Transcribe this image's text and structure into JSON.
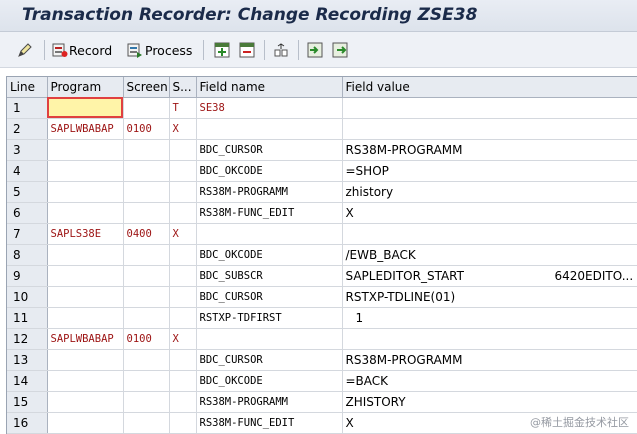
{
  "window": {
    "title": "Transaction Recorder: Change Recording ZSE38"
  },
  "toolbar": {
    "record_label": "Record",
    "process_label": "Process",
    "icons": [
      "edit-pencil-icon",
      "record-icon",
      "process-icon",
      "insert-row-icon",
      "delete-row-icon",
      "screen-icon",
      "import-icon",
      "export-icon"
    ]
  },
  "grid": {
    "columns": [
      "Line",
      "Program",
      "Screen",
      "S...",
      "Field name",
      "Field value"
    ],
    "rows": [
      {
        "line": "1",
        "program": "",
        "screen": "",
        "s": "T",
        "field": "SE38",
        "value": "",
        "value2": ""
      },
      {
        "line": "2",
        "program": "SAPLWBABAP",
        "screen": "0100",
        "s": "X",
        "field": "",
        "value": "",
        "value2": ""
      },
      {
        "line": "3",
        "program": "",
        "screen": "",
        "s": "",
        "field": "BDC_CURSOR",
        "value": "RS38M-PROGRAMM",
        "value2": ""
      },
      {
        "line": "4",
        "program": "",
        "screen": "",
        "s": "",
        "field": "BDC_OKCODE",
        "value": "=SHOP",
        "value2": ""
      },
      {
        "line": "5",
        "program": "",
        "screen": "",
        "s": "",
        "field": "RS38M-PROGRAMM",
        "value": "zhistory",
        "value2": ""
      },
      {
        "line": "6",
        "program": "",
        "screen": "",
        "s": "",
        "field": "RS38M-FUNC_EDIT",
        "value": "X",
        "value2": ""
      },
      {
        "line": "7",
        "program": "SAPLS38E",
        "screen": "0400",
        "s": "X",
        "field": "",
        "value": "",
        "value2": ""
      },
      {
        "line": "8",
        "program": "",
        "screen": "",
        "s": "",
        "field": "BDC_OKCODE",
        "value": "/EWB_BACK",
        "value2": ""
      },
      {
        "line": "9",
        "program": "",
        "screen": "",
        "s": "",
        "field": "BDC_SUBSCR",
        "value": "SAPLEDITOR_START",
        "value2": "6420EDITO..."
      },
      {
        "line": "10",
        "program": "",
        "screen": "",
        "s": "",
        "field": "BDC_CURSOR",
        "value": "RSTXP-TDLINE(01)",
        "value2": ""
      },
      {
        "line": "11",
        "program": "",
        "screen": "",
        "s": "",
        "field": "RSTXP-TDFIRST",
        "value": "1",
        "value2": ""
      },
      {
        "line": "12",
        "program": "SAPLWBABAP",
        "screen": "0100",
        "s": "X",
        "field": "",
        "value": "",
        "value2": ""
      },
      {
        "line": "13",
        "program": "",
        "screen": "",
        "s": "",
        "field": "BDC_CURSOR",
        "value": "RS38M-PROGRAMM",
        "value2": ""
      },
      {
        "line": "14",
        "program": "",
        "screen": "",
        "s": "",
        "field": "BDC_OKCODE",
        "value": "=BACK",
        "value2": ""
      },
      {
        "line": "15",
        "program": "",
        "screen": "",
        "s": "",
        "field": "RS38M-PROGRAMM",
        "value": "ZHISTORY",
        "value2": ""
      },
      {
        "line": "16",
        "program": "",
        "screen": "",
        "s": "",
        "field": "RS38M-FUNC_EDIT",
        "value": "X",
        "value2": ""
      }
    ]
  },
  "watermark": "@稀土掘金技术社区",
  "colors": {
    "red_text": "#9c1212",
    "selected_cell": "#fff4a8",
    "header_bg": "#e7ebf1"
  }
}
